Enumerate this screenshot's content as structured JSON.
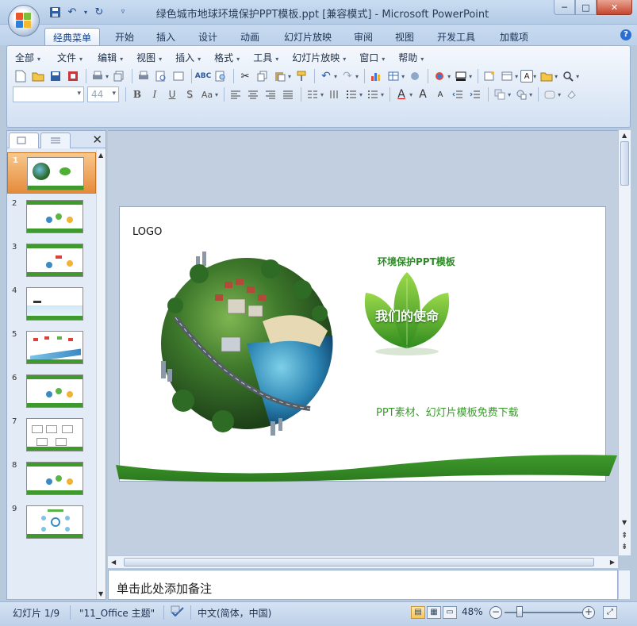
{
  "window": {
    "title": "绿色城市地球环境保护PPT模板.ppt [兼容模式] - Microsoft PowerPoint",
    "minimize_glyph": "─",
    "maximize_glyph": "□",
    "close_glyph": "✕"
  },
  "quick_access": {
    "save_icon": "save-icon",
    "undo_icon": "undo-icon",
    "redo_icon": "redo-icon",
    "customize_icon": "customize-qat-icon"
  },
  "ribbon_tabs": [
    {
      "label": "经典菜单",
      "active": true
    },
    {
      "label": "开始"
    },
    {
      "label": "插入"
    },
    {
      "label": "设计"
    },
    {
      "label": "动画"
    },
    {
      "label": "幻灯片放映"
    },
    {
      "label": "审阅"
    },
    {
      "label": "视图"
    },
    {
      "label": "开发工具"
    },
    {
      "label": "加载项"
    }
  ],
  "menus": [
    "全部",
    "文件",
    "编辑",
    "视图",
    "插入",
    "格式",
    "工具",
    "幻灯片放映",
    "窗口",
    "帮助"
  ],
  "font_combo": {
    "family": "",
    "size": "44"
  },
  "format_buttons": {
    "bold": "B",
    "italic": "I",
    "underline": "U",
    "shadow": "S",
    "case": "Aa",
    "font_color": "A",
    "grow": "A",
    "shrink": "A"
  },
  "slides_panel": {
    "close_glyph": "✕",
    "slides": [
      {
        "number": "1",
        "selected": true
      },
      {
        "number": "2"
      },
      {
        "number": "3"
      },
      {
        "number": "4"
      },
      {
        "number": "5"
      },
      {
        "number": "6"
      },
      {
        "number": "7"
      },
      {
        "number": "8"
      },
      {
        "number": "9"
      }
    ]
  },
  "slide": {
    "logo": "LOGO",
    "subtitle": "环境保护PPT模板",
    "leaf_title": "我们的使命",
    "tagline": "PPT素材、幻灯片模板免费下载"
  },
  "notes": {
    "placeholder": "单击此处添加备注"
  },
  "status_bar": {
    "slide_counter": "幻灯片 1/9",
    "theme": "\"11_Office 主题\"",
    "language": "中文(简体，中国)",
    "zoom": "48%",
    "zoom_fraction": 0.48
  },
  "colors": {
    "accent_green": "#3d9a2e",
    "ribbon_blue": "#bcd1ea",
    "selected_thumb": "#e58b3b"
  }
}
